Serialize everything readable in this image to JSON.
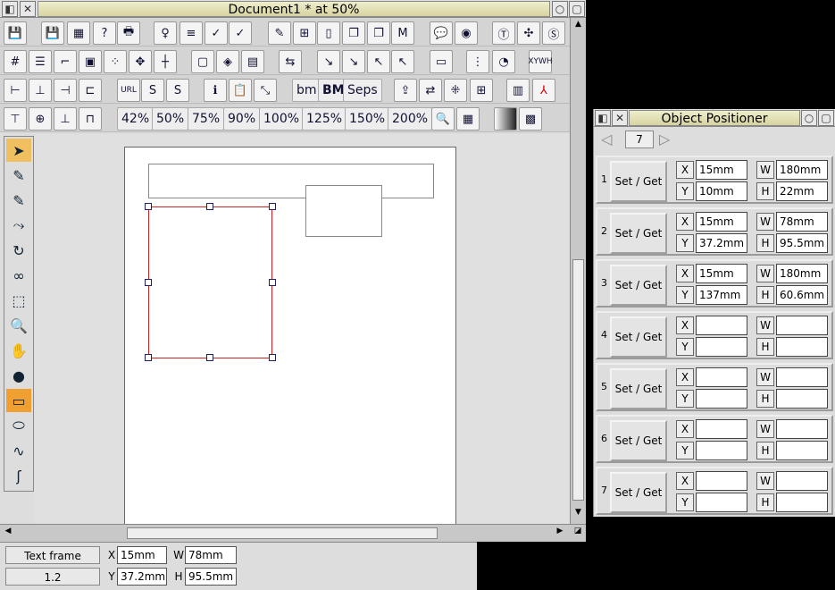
{
  "main_window": {
    "title": "Document1 * at 50%",
    "zoom_buttons": [
      "42%",
      "50%",
      "75%",
      "90%",
      "100%",
      "125%",
      "150%",
      "200%"
    ],
    "text_buttons": [
      "bm",
      "BM",
      "Seps"
    ],
    "toolbar_icon_names": [
      "save-icon",
      "save-as-icon",
      "print-setup-icon",
      "help-icon",
      "print-icon"
    ]
  },
  "status": {
    "object_type": "Text frame",
    "number": "1.2",
    "x_label": "X",
    "y_label": "Y",
    "w_label": "W",
    "h_label": "H",
    "x": "15mm",
    "y": "37.2mm",
    "w": "78mm",
    "h": "95.5mm"
  },
  "positioner": {
    "title": "Object Positioner",
    "count": "7",
    "set_get_label": "Set / Get",
    "rows": [
      {
        "num": "1",
        "x": "15mm",
        "y": "10mm",
        "w": "180mm",
        "h": "22mm"
      },
      {
        "num": "2",
        "x": "15mm",
        "y": "37.2mm",
        "w": "78mm",
        "h": "95.5mm"
      },
      {
        "num": "3",
        "x": "15mm",
        "y": "137mm",
        "w": "180mm",
        "h": "60.6mm"
      },
      {
        "num": "4",
        "x": "",
        "y": "",
        "w": "",
        "h": ""
      },
      {
        "num": "5",
        "x": "",
        "y": "",
        "w": "",
        "h": ""
      },
      {
        "num": "6",
        "x": "",
        "y": "",
        "w": "",
        "h": ""
      },
      {
        "num": "7",
        "x": "",
        "y": "",
        "w": "",
        "h": ""
      }
    ]
  }
}
